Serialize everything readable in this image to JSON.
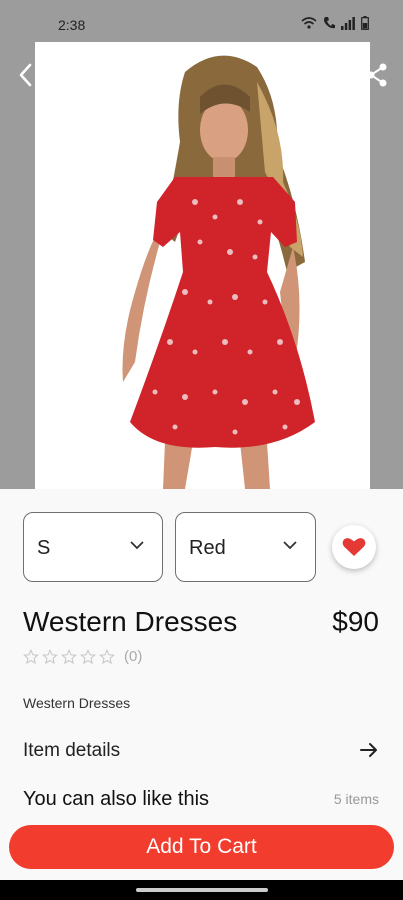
{
  "status_bar": {
    "time": "2:38"
  },
  "product": {
    "name": "Western Dresses",
    "price": "$90",
    "subtitle": "Western Dresses",
    "rating_count": "(0)",
    "rating": 0,
    "image_icon": "dress-photo"
  },
  "options": {
    "size": {
      "selected": "S"
    },
    "color": {
      "selected": "Red"
    }
  },
  "details": {
    "label": "Item details"
  },
  "related": {
    "label": "You can also like this",
    "count": "5 items"
  },
  "cart": {
    "label": "Add To Cart"
  },
  "colors": {
    "accent": "#f23c2e",
    "heart": "#e53935",
    "hero_bg": "#9c9c9c"
  }
}
